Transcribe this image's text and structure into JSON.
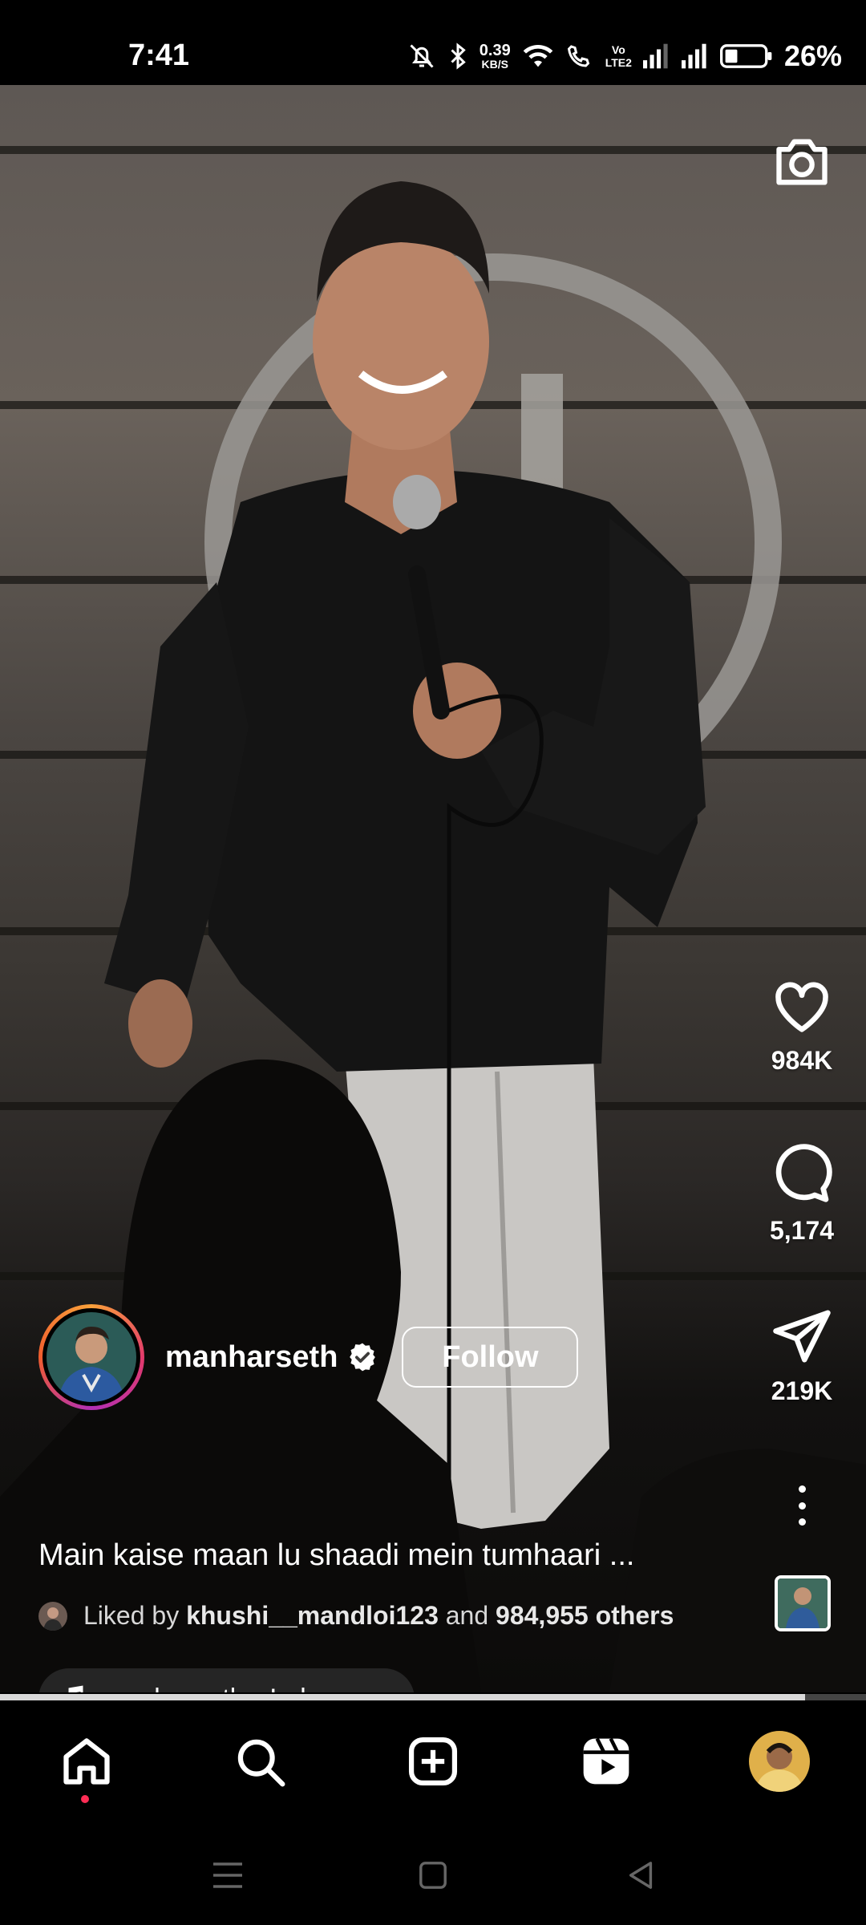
{
  "status_bar": {
    "time": "7:41",
    "net_speed_value": "0.39",
    "net_speed_unit": "KB/S",
    "volte_top": "Vo",
    "volte_bottom": "LTE2",
    "battery_percent": "26%"
  },
  "reel": {
    "author": {
      "username": "manharseth",
      "verified": true,
      "follow_label": "Follow"
    },
    "caption": "Main kaise maan lu shaadi mein tumhaari ...",
    "liked_by": {
      "prefix": "Liked by",
      "user": "khushi__mandloi123",
      "connector": "and",
      "others": "984,955 others"
    },
    "audio": {
      "label": "manharseth • Lehenga",
      "icon": "music-note-icon"
    },
    "actions": {
      "likes": "984K",
      "comments": "5,174",
      "shares": "219K"
    },
    "progress_fraction": 0.93
  },
  "bottom_nav": {
    "items": [
      "home-icon",
      "search-icon",
      "create-icon",
      "reels-icon",
      "profile-avatar"
    ],
    "active": "home-icon"
  },
  "colors": {
    "background": "#000000",
    "notification_dot": "#ff2d55",
    "text": "#ffffff"
  }
}
